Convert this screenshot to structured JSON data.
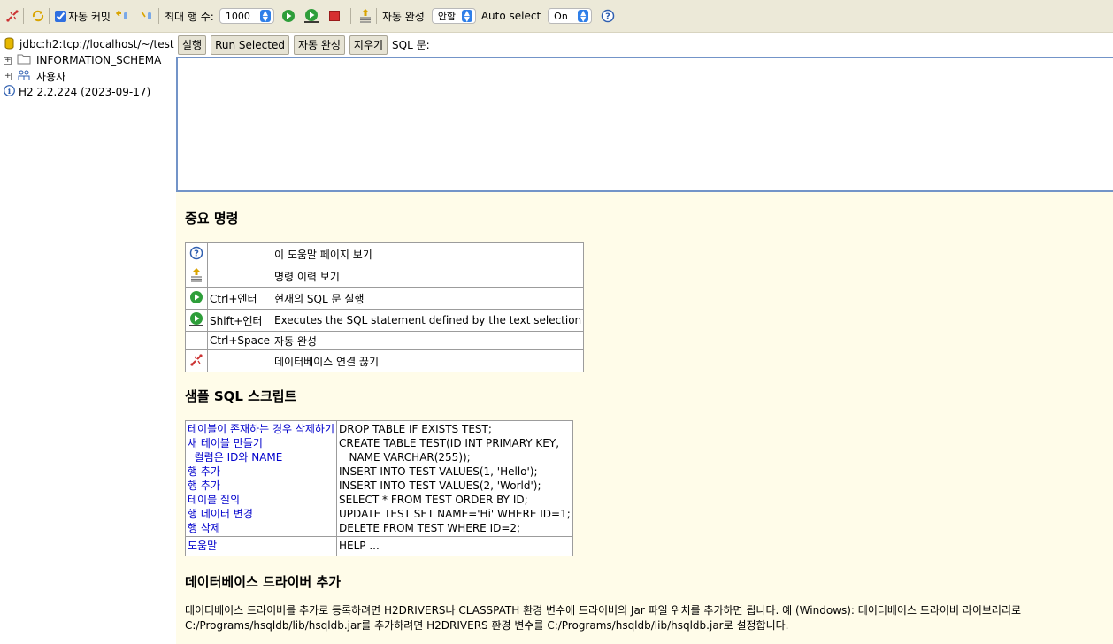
{
  "toolbar": {
    "auto_commit_label": "자동 커밋",
    "max_rows_label": "최대 행 수:",
    "max_rows_value": "1000",
    "autocomplete_label": "자동 완성",
    "autocomplete_value": "안함",
    "auto_select_label": "Auto select",
    "auto_select_value": "On",
    "icons": [
      "disconnect-icon",
      "refresh-icon",
      "rollback-icon",
      "commit-icon",
      "run-icon",
      "run-selected-icon",
      "stop-icon",
      "history-icon",
      "help-icon"
    ]
  },
  "tree": {
    "connection": "jdbc:h2:tcp://localhost/~/test",
    "nodes": [
      "INFORMATION_SCHEMA",
      "사용자"
    ],
    "version": "H2 2.2.224 (2023-09-17)"
  },
  "query": {
    "run_label": "실행",
    "run_selected_label": "Run Selected",
    "autocomplete_label": "자동 완성",
    "clear_label": "지우기",
    "sql_label": "SQL 문:"
  },
  "help": {
    "important_title": "중요 명령",
    "commands": [
      {
        "icon": "help-icon",
        "key": "",
        "desc": "이 도움말 페이지 보기"
      },
      {
        "icon": "history-icon",
        "key": "",
        "desc": "명령 이력 보기"
      },
      {
        "icon": "run-icon",
        "key": "Ctrl+엔터",
        "desc": "현재의 SQL 문 실행"
      },
      {
        "icon": "run-selected-icon",
        "key": "Shift+엔터",
        "desc": "Executes the SQL statement defined by the text selection"
      },
      {
        "icon": "",
        "key": "Ctrl+Space",
        "desc": "자동 완성"
      },
      {
        "icon": "disconnect-icon",
        "key": "",
        "desc": "데이터베이스 연결 끊기"
      }
    ],
    "sample_title": "샘플 SQL 스크립트",
    "script_links": [
      "테이블이 존재하는 경우 삭제하기",
      "새 테이블 만들기",
      "  컬럼은 ID와 NAME",
      "행 추가",
      "행 추가",
      "테이블 질의",
      "행 데이터 변경",
      "행 삭제"
    ],
    "script_sql": [
      "DROP TABLE IF EXISTS TEST;",
      "CREATE TABLE TEST(ID INT PRIMARY KEY,",
      "   NAME VARCHAR(255));",
      "INSERT INTO TEST VALUES(1, 'Hello');",
      "INSERT INTO TEST VALUES(2, 'World');",
      "SELECT * FROM TEST ORDER BY ID;",
      "UPDATE TEST SET NAME='Hi' WHERE ID=1;",
      "DELETE FROM TEST WHERE ID=2;"
    ],
    "help_link": "도움말",
    "help_sql": "HELP ...",
    "driver_title": "데이터베이스 드라이버 추가",
    "driver_text_1": "데이터베이스 드라이버를 추가로 등록하려면 H2DRIVERS나 CLASSPATH 환경 변수에 드라이버의 Jar 파일 위치를 추가하면 됩니다. 예 (Windows): 데이터베이스 드라이버 라이브러리로",
    "driver_text_2": "C:/Programs/hsqldb/lib/hsqldb.jar를 추가하려면 H2DRIVERS 환경 변수를 C:/Programs/hsqldb/lib/hsqldb.jar로 설정합니다."
  },
  "colors": {
    "toolbar_bg": "#ece9d8",
    "help_bg": "#fffce9",
    "link": "#0000cc",
    "run_green": "#2e9e3a",
    "stop_red": "#d63030",
    "sql_border": "#7394c8"
  }
}
